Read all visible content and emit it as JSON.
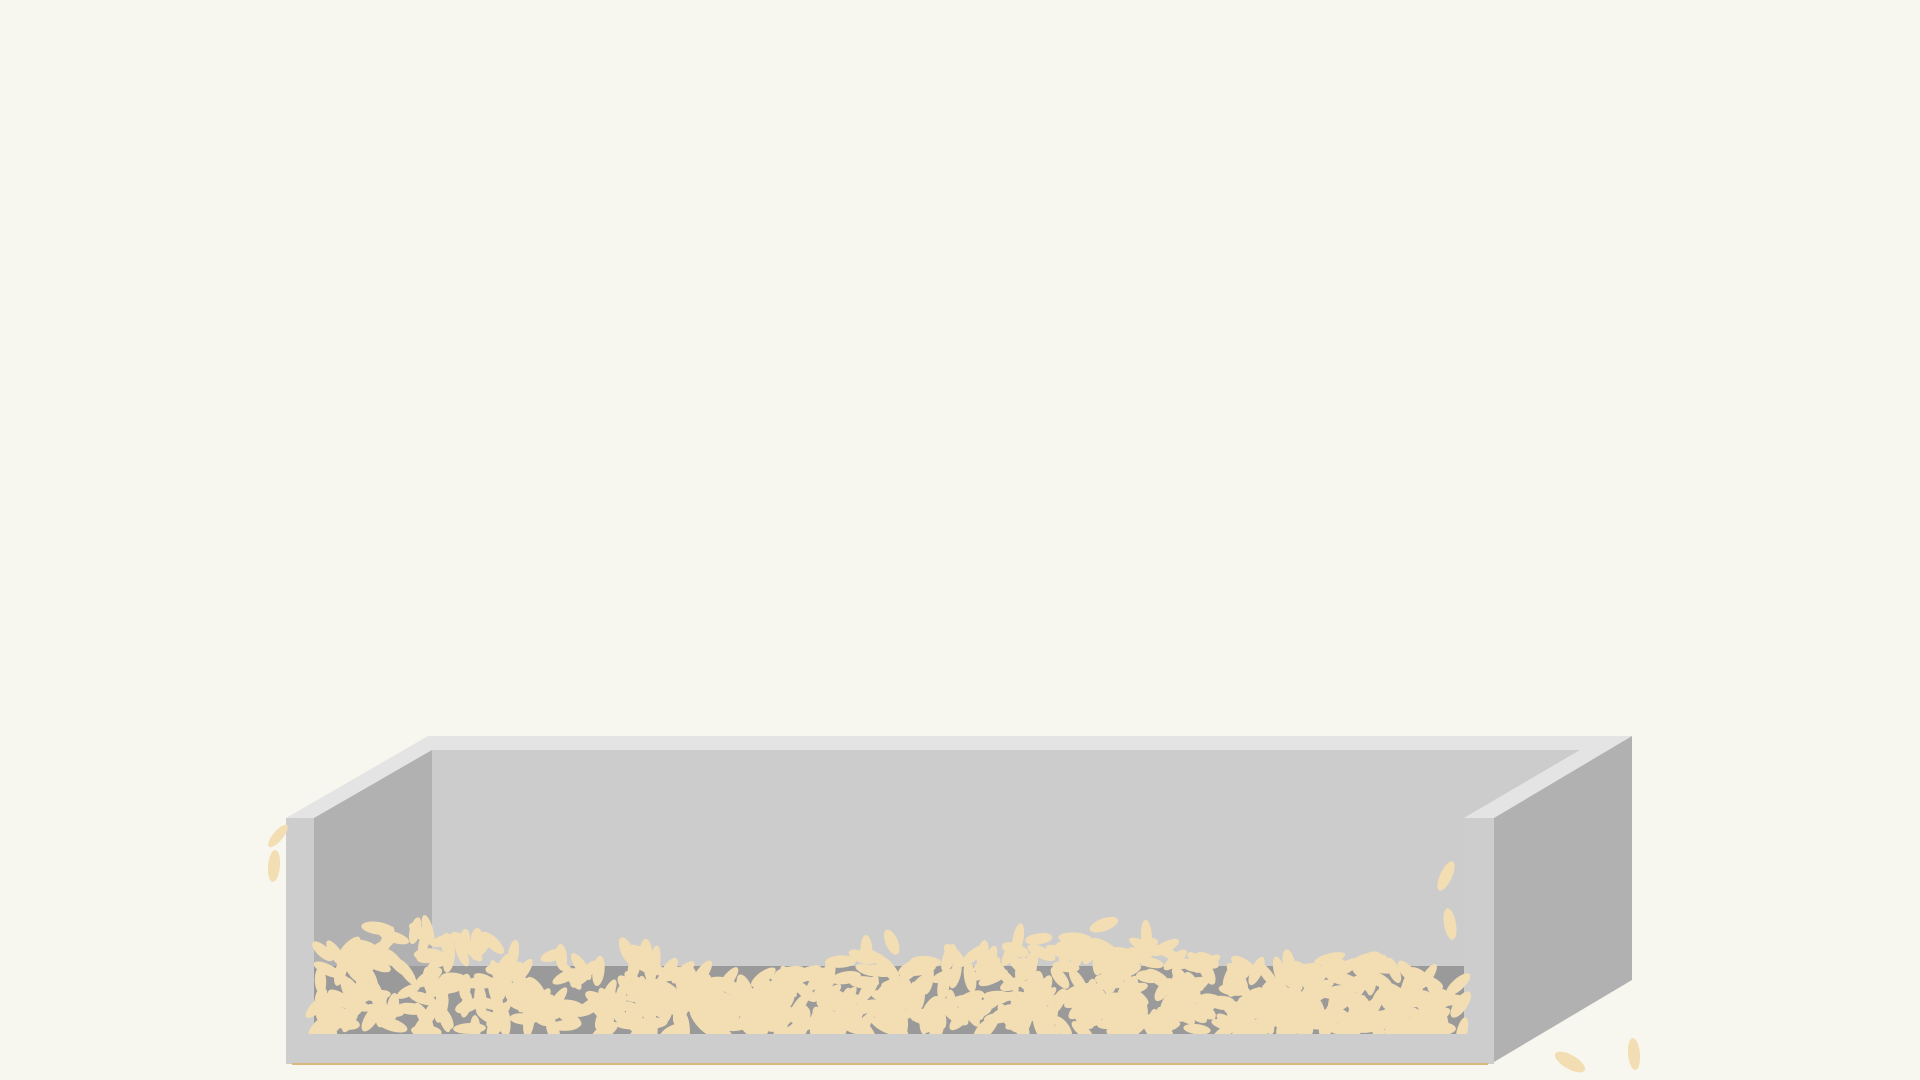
{
  "scene": {
    "subject": "rice-tray",
    "colors": {
      "background": "#f8f7ef",
      "tray_rim": "#e4e4e4",
      "tray_back_wall": "#cccccc",
      "tray_side": "#b1b1b1",
      "tray_front": "#cdcdcd",
      "tray_inner_floor": "#9a9a9a",
      "rice_grain": "#f3deb3",
      "rice_shadow": "#d9b97a"
    }
  }
}
